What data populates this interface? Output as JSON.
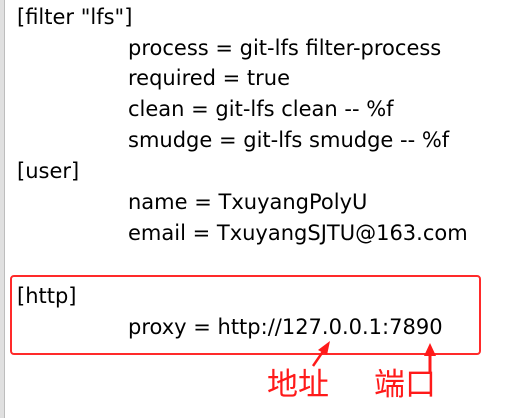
{
  "lines": [
    {
      "text": "[filter \"lfs\"]",
      "indent": 0
    },
    {
      "text": "process = git-lfs filter-process",
      "indent": 1
    },
    {
      "text": "required = true",
      "indent": 1
    },
    {
      "text": "clean = git-lfs clean -- %f",
      "indent": 1
    },
    {
      "text": "smudge = git-lfs smudge -- %f",
      "indent": 1
    },
    {
      "text": "[user]",
      "indent": 0
    },
    {
      "text": "name = TxuyangPolyU",
      "indent": 1
    },
    {
      "text": "email = TxuyangSJTU@163.com",
      "indent": 1
    },
    {
      "text": "[http]",
      "indent": 0
    },
    {
      "text": "proxy = http://127.0.0.1:7890",
      "indent": 1
    }
  ],
  "annotations": {
    "address": "地址",
    "port": "端口"
  },
  "colors": {
    "highlight": "#ff2a2a"
  }
}
